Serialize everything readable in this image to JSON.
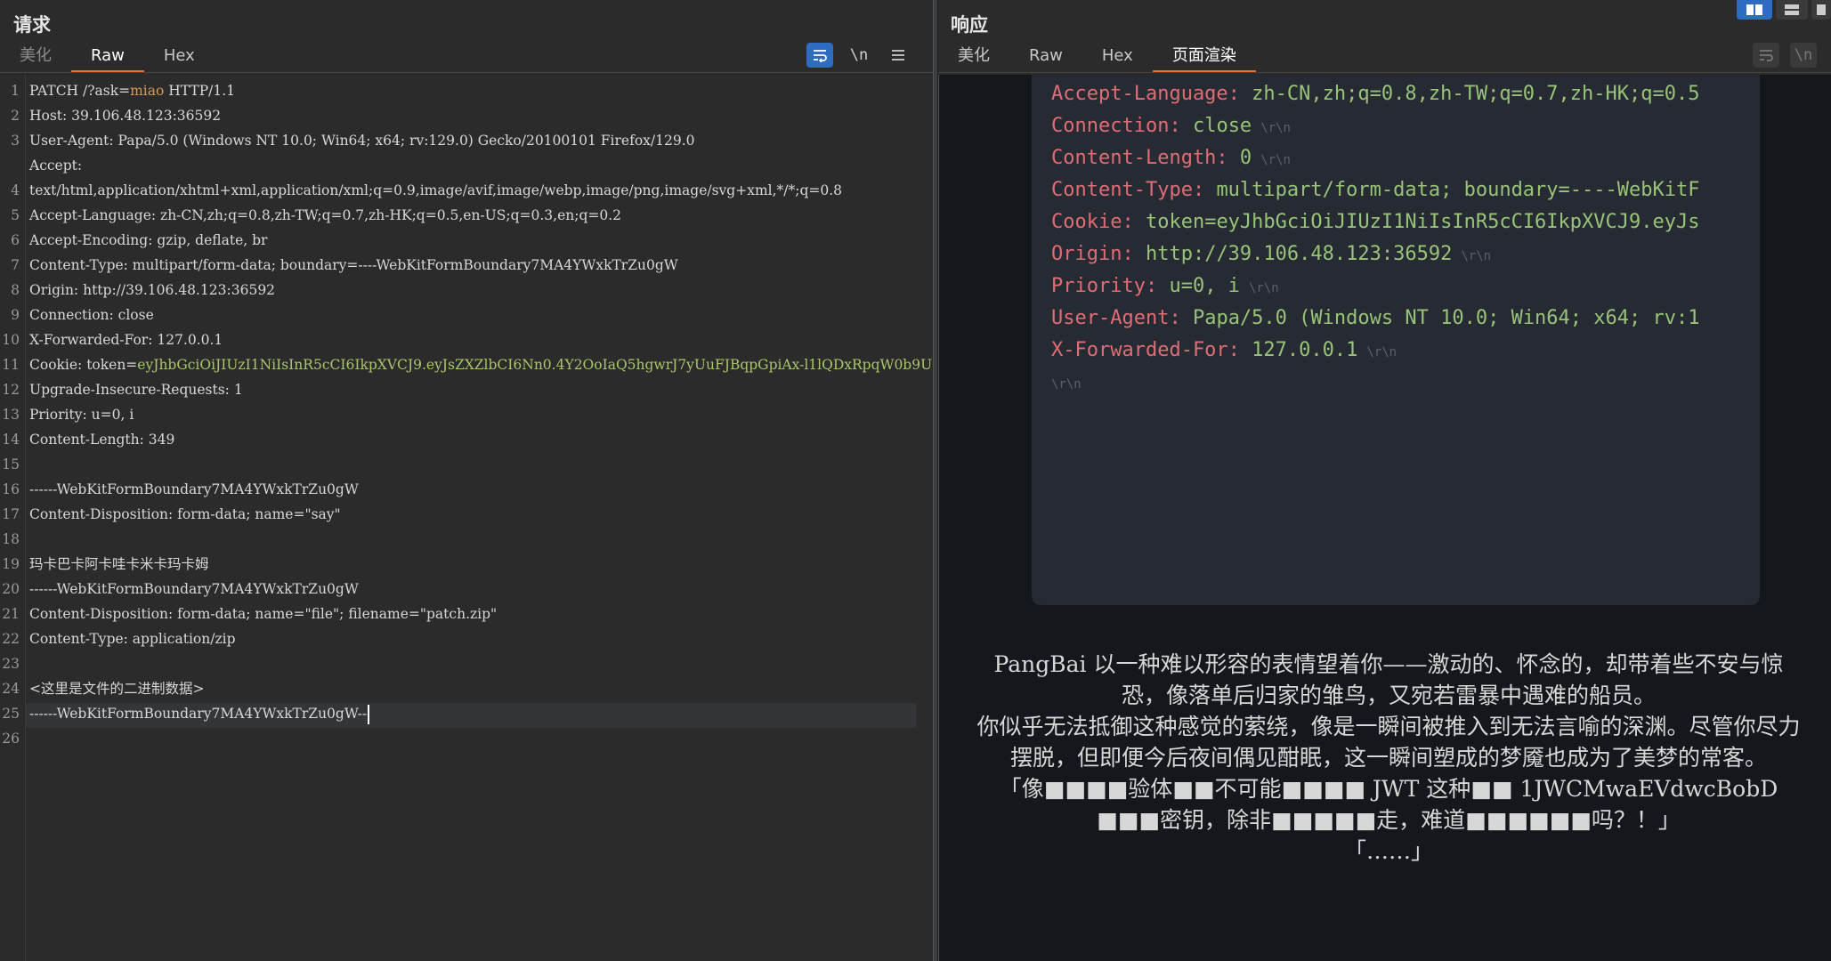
{
  "request": {
    "title": "请求",
    "tabs": [
      "美化",
      "Raw",
      "Hex"
    ],
    "active_tab": "Raw",
    "tools": {
      "wrap_icon": "wrap-lines-icon",
      "newline_label": "\\n",
      "menu_icon": "hamburger-menu-icon"
    },
    "lines": [
      "PATCH /?ask=miao HTTP/1.1",
      "Host: 39.106.48.123:36592",
      "User-Agent: Papa/5.0 (Windows NT 10.0; Win64; x64; rv:129.0) Gecko/20100101 Firefox/129.0",
      "Accept:",
      "text/html,application/xhtml+xml,application/xml;q=0.9,image/avif,image/webp,image/png,image/svg+xml,*/*;q=0.8",
      "Accept-Language: zh-CN,zh;q=0.8,zh-TW;q=0.7,zh-HK;q=0.5,en-US;q=0.3,en;q=0.2",
      "Accept-Encoding: gzip, deflate, br",
      "Content-Type: multipart/form-data; boundary=----WebKitFormBoundary7MA4YWxkTrZu0gW",
      "Origin: http://39.106.48.123:36592",
      "Connection: close",
      "X-Forwarded-For: 127.0.0.1",
      "Cookie: token=eyJhbGciOiJIUzI1NiIsInR5cCI6IkpXVCJ9.eyJsZXZlbCI6Nn0.4Y2OoIaQ5hgwrJ7yUuFJBqpGpiAx-l1lQDxRpqW0b9U",
      "Upgrade-Insecure-Requests: 1",
      "Priority: u=0, i",
      "Content-Length: 349",
      "",
      "------WebKitFormBoundary7MA4YWxkTrZu0gW",
      "Content-Disposition: form-data; name=\"say\"",
      "",
      "玛卡巴卡阿卡哇卡米卡玛卡姆",
      "------WebKitFormBoundary7MA4YWxkTrZu0gW",
      "Content-Disposition: form-data; name=\"file\"; filename=\"patch.zip\"",
      "Content-Type: application/zip",
      "",
      "<这里是文件的二进制数据>",
      "------WebKitFormBoundary7MA4YWxkTrZu0gW--",
      ""
    ],
    "line_numbers": [
      "1",
      "2",
      "3",
      "",
      "4",
      "5",
      "6",
      "7",
      "8",
      "9",
      "10",
      "11",
      "12",
      "13",
      "14",
      "15",
      "16",
      "17",
      "18",
      "19",
      "20",
      "21",
      "22",
      "23",
      "24",
      "25",
      "26"
    ]
  },
  "response": {
    "title": "响应",
    "tabs": [
      "美化",
      "Raw",
      "Hex",
      "页面渲染"
    ],
    "active_tab": "页面渲染",
    "headers": [
      {
        "key": "Accept-Language",
        "value": "zh-CN,zh;q=0.8,zh-TW;q=0.7,zh-HK;q=0.5",
        "crlf": ""
      },
      {
        "key": "Connection",
        "value": "close",
        "crlf": "\\r\\n"
      },
      {
        "key": "Content-Length",
        "value": "0",
        "crlf": "\\r\\n"
      },
      {
        "key": "Content-Type",
        "value": "multipart/form-data; boundary=----WebKitF",
        "crlf": ""
      },
      {
        "key": "Cookie",
        "value": "token=eyJhbGciOiJIUzI1NiIsInR5cCI6IkpXVCJ9.eyJs",
        "crlf": ""
      },
      {
        "key": "Origin",
        "value": "http://39.106.48.123:36592",
        "crlf": "\\r\\n"
      },
      {
        "key": "Priority",
        "value": "u=0, i",
        "crlf": "\\r\\n"
      },
      {
        "key": "User-Agent",
        "value": "Papa/5.0 (Windows NT 10.0; Win64; x64; rv:1",
        "crlf": ""
      },
      {
        "key": "X-Forwarded-For",
        "value": "127.0.0.1",
        "crlf": "\\r\\n"
      }
    ],
    "trailing_crlf": "\\r\\n",
    "story": [
      "PangBai 以一种难以形容的表情望着你——激动的、怀念的，却带着些不安与惊恐，像落单后归家的雏鸟，又宛若雷暴中遇难的船员。",
      "你似乎无法抵御这种感觉的萦绕，像是一瞬间被推入到无法言喻的深渊。尽管你尽力摆脱，但即便今后夜间偶见酣眠，这一瞬间塑成的梦魇也成为了美梦的常客。",
      "「像■■■■验体■■不可能■■■■ JWT 这种■■ 1JWCMwaEVdwcBobD ■■■密钥，除非■■■■■走，难道■■■■■■吗？！」",
      "「……」"
    ]
  },
  "colors": {
    "accent_tab": "#e8702a",
    "toggle_blue": "#2d6cc0",
    "header_key": "#e06c75",
    "header_value": "#98c379"
  }
}
